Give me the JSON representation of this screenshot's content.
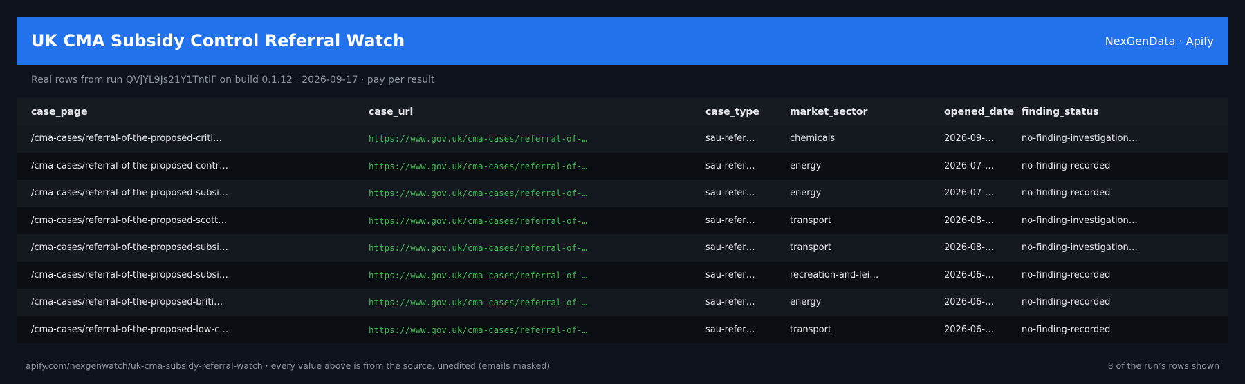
{
  "header": {
    "title": "UK CMA Subsidy Control Referral Watch",
    "brand": "NexGenData · Apify"
  },
  "subtitle": "Real rows from run QVjYL9Js21Y1TntiF on build 0.1.12 · 2026-09-17 · pay per result",
  "table": {
    "columns": [
      "case_page",
      "case_url",
      "case_type",
      "market_sector",
      "opened_date",
      "finding_status"
    ],
    "rows": [
      [
        "/cma-cases/referral-of-the-proposed-criti…",
        "https://www.gov.uk/cma-cases/referral-of-…",
        "sau-refer…",
        "chemicals",
        "2026-09-…",
        "no-finding-investigation…"
      ],
      [
        "/cma-cases/referral-of-the-proposed-contr…",
        "https://www.gov.uk/cma-cases/referral-of-…",
        "sau-refer…",
        "energy",
        "2026-07-…",
        "no-finding-recorded"
      ],
      [
        "/cma-cases/referral-of-the-proposed-subsi…",
        "https://www.gov.uk/cma-cases/referral-of-…",
        "sau-refer…",
        "energy",
        "2026-07-…",
        "no-finding-recorded"
      ],
      [
        "/cma-cases/referral-of-the-proposed-scott…",
        "https://www.gov.uk/cma-cases/referral-of-…",
        "sau-refer…",
        "transport",
        "2026-08-…",
        "no-finding-investigation…"
      ],
      [
        "/cma-cases/referral-of-the-proposed-subsi…",
        "https://www.gov.uk/cma-cases/referral-of-…",
        "sau-refer…",
        "transport",
        "2026-08-…",
        "no-finding-investigation…"
      ],
      [
        "/cma-cases/referral-of-the-proposed-subsi…",
        "https://www.gov.uk/cma-cases/referral-of-…",
        "sau-refer…",
        "recreation-and-lei…",
        "2026-06-…",
        "no-finding-recorded"
      ],
      [
        "/cma-cases/referral-of-the-proposed-briti…",
        "https://www.gov.uk/cma-cases/referral-of-…",
        "sau-refer…",
        "energy",
        "2026-06-…",
        "no-finding-recorded"
      ],
      [
        "/cma-cases/referral-of-the-proposed-low-c…",
        "https://www.gov.uk/cma-cases/referral-of-…",
        "sau-refer…",
        "transport",
        "2026-06-…",
        "no-finding-recorded"
      ]
    ]
  },
  "footer": {
    "left": "apify.com/nexgenwatch/uk-cma-subsidy-referral-watch  ·  every value above is from the source, unedited (emails masked)",
    "right": "8 of the run’s rows shown"
  },
  "colors": {
    "header_bg": "#2172eb",
    "page_bg": "#0f131b",
    "url_green": "#3fb950",
    "muted_text": "#8f959f"
  }
}
